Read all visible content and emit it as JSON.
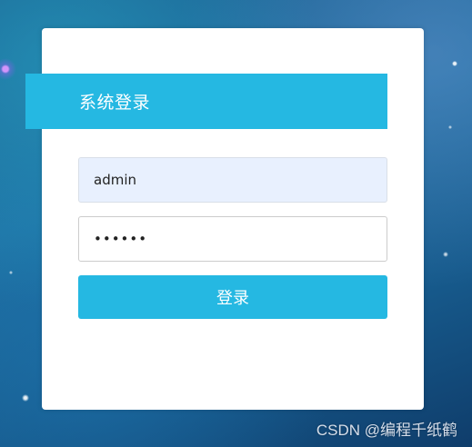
{
  "login": {
    "title": "系统登录",
    "username_value": "admin",
    "password_masked": "••••••",
    "submit_label": "登录"
  },
  "watermark": {
    "text": "CSDN @编程千纸鹤"
  },
  "colors": {
    "accent": "#25b8e2",
    "card": "#ffffff",
    "autofill": "#e8f0fe"
  }
}
